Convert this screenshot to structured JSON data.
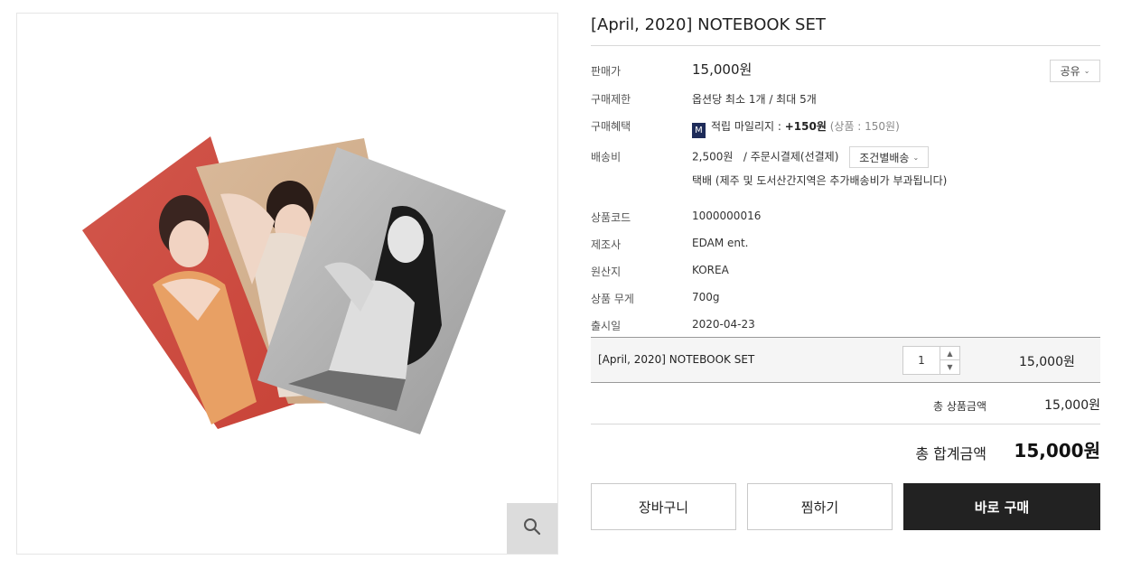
{
  "product": {
    "title": "[April, 2020] NOTEBOOK SET",
    "image_alt": "notebook-set-photo"
  },
  "share": {
    "label": "공유",
    "icon": "chevron-down-icon"
  },
  "details": {
    "price": {
      "label": "판매가",
      "value": "15,000원"
    },
    "purchase_limit": {
      "label": "구매제한",
      "value": "옵션당 최소 1개 / 최대 5개"
    },
    "benefit": {
      "label": "구매혜택",
      "badge": "M",
      "text": "적립 마일리지 : ",
      "amount": "+150원",
      "note": "(상품 : 150원)"
    },
    "shipping": {
      "label": "배송비",
      "value": "2,500원",
      "method": "/ 주문시결제(선결제)",
      "condition_button": "조건별배송",
      "note": "택배 (제주 및 도서산간지역은 추가배송비가 부과됩니다)"
    },
    "product_code": {
      "label": "상품코드",
      "value": "1000000016"
    },
    "manufacturer": {
      "label": "제조사",
      "value": "EDAM ent."
    },
    "origin": {
      "label": "원산지",
      "value": "KOREA"
    },
    "weight": {
      "label": "상품 무게",
      "value": "700g"
    },
    "release_date": {
      "label": "출시일",
      "value": "2020-04-23"
    }
  },
  "selected_option": {
    "name": "[April, 2020] NOTEBOOK SET",
    "quantity": "1",
    "price": "15,000원"
  },
  "subtotal": {
    "label": "총 상품금액",
    "value": "15,000원"
  },
  "total": {
    "label": "총 합계금액",
    "value": "15,000원"
  },
  "buttons": {
    "cart": "장바구니",
    "wishlist": "찜하기",
    "buy_now": "바로 구매"
  },
  "colors": {
    "buy_button": "#222222",
    "mileage_badge": "#1e2c5a",
    "zoom_button": "#dcdcdc"
  }
}
